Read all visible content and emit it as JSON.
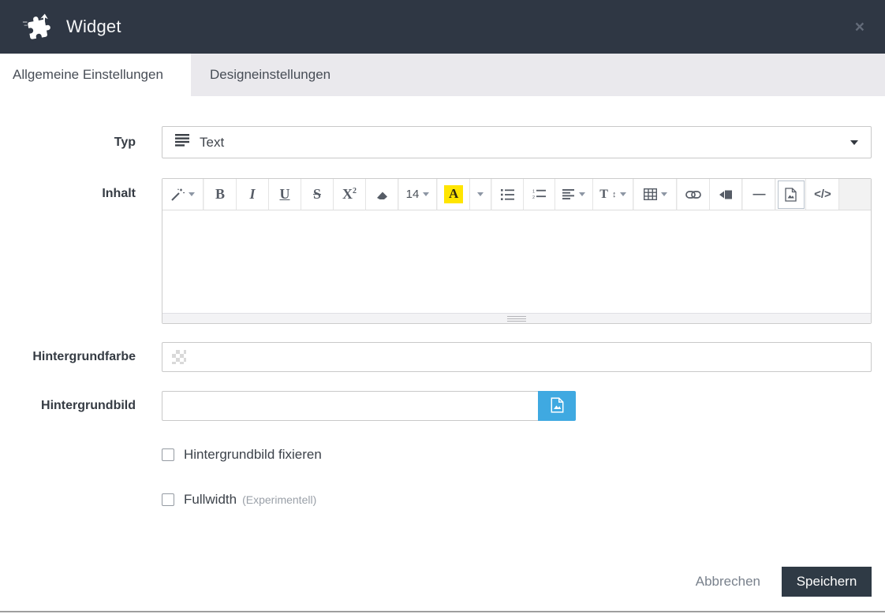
{
  "header": {
    "title": "Widget",
    "close_glyph": "×"
  },
  "tabs": {
    "general": "Allgemeine Einstellungen",
    "design": "Designeinstellungen"
  },
  "form": {
    "typ_label": "Typ",
    "typ_value": "Text",
    "inhalt_label": "Inhalt",
    "inhalt_content": "",
    "farbe_label": "Hintergrundfarbe",
    "farbe_value": "",
    "bild_label": "Hintergrundbild",
    "bild_value": "",
    "checkbox_fix_label": "Hintergrundbild fixieren",
    "checkbox_fullwidth_label": "Fullwidth",
    "checkbox_fullwidth_note": "(Experimentell)"
  },
  "toolbar": {
    "bold": "B",
    "italic": "I",
    "underline": "U",
    "strikethrough": "S",
    "superscript_base": "X",
    "superscript_exp": "2",
    "font_size": "14",
    "font_color": "A",
    "line_height": "T",
    "line_height_arrow": "↕",
    "horizontal_rule": "—",
    "code_view": "</>"
  },
  "footer": {
    "cancel": "Abbrechen",
    "save": "Speichern"
  },
  "colors": {
    "header_bg": "#2f3744",
    "tab_inactive_bg": "#eae9ed",
    "accent_blue": "#3fa9e1",
    "highlight_yellow": "#ffe500",
    "save_button_bg": "#2f3a45"
  }
}
